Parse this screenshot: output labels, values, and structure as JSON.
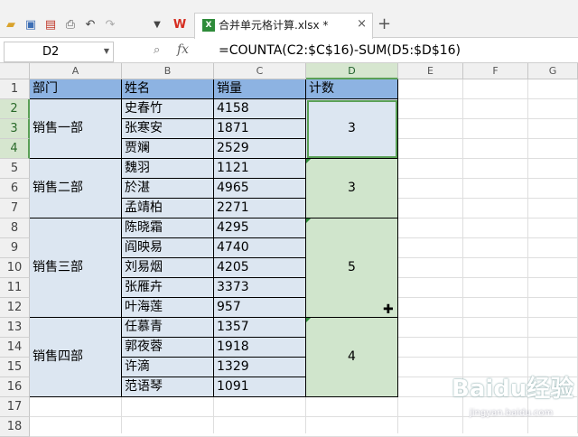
{
  "app": {
    "tab_title": "合并单元格计算.xlsx *",
    "file_icon": "X",
    "new_tab": "+",
    "close": "×"
  },
  "toolbar": {
    "icons": [
      "folder-open-icon",
      "save-icon",
      "pdf-icon",
      "print-icon",
      "undo-icon",
      "redo-icon",
      "dropdown-icon"
    ],
    "wps_logo": "W"
  },
  "formula_bar": {
    "name_box": "D2",
    "fx": "fx",
    "formula": "=COUNTA(C2:$C$16)-SUM(D5:$D$16)"
  },
  "columns": [
    "A",
    "B",
    "C",
    "D",
    "E",
    "F",
    "G"
  ],
  "selected_column": "D",
  "rows": [
    "1",
    "2",
    "3",
    "4",
    "5",
    "6",
    "7",
    "8",
    "9",
    "10",
    "11",
    "12",
    "13",
    "14",
    "15",
    "16",
    "17",
    "18"
  ],
  "header": [
    "部门",
    "姓名",
    "销量",
    "计数"
  ],
  "departments": [
    "销售一部",
    "销售二部",
    "销售三部",
    "销售四部"
  ],
  "names": [
    "史春竹",
    "张寒安",
    "贾斓",
    "魏羽",
    "於湛",
    "孟靖柏",
    "陈晓霜",
    "阎映易",
    "刘易烟",
    "张雁卉",
    "叶海莲",
    "任慕青",
    "郭夜蓉",
    "许滴",
    "范语琴"
  ],
  "sales": [
    "4158",
    "1871",
    "2529",
    "1121",
    "4965",
    "2271",
    "4295",
    "4740",
    "4205",
    "3373",
    "957",
    "1357",
    "1918",
    "1329",
    "1091"
  ],
  "counts": [
    "3",
    "3",
    "5",
    "4"
  ],
  "watermark": {
    "brand": "Baidu经验",
    "site": "jingyan.baidu.com"
  }
}
